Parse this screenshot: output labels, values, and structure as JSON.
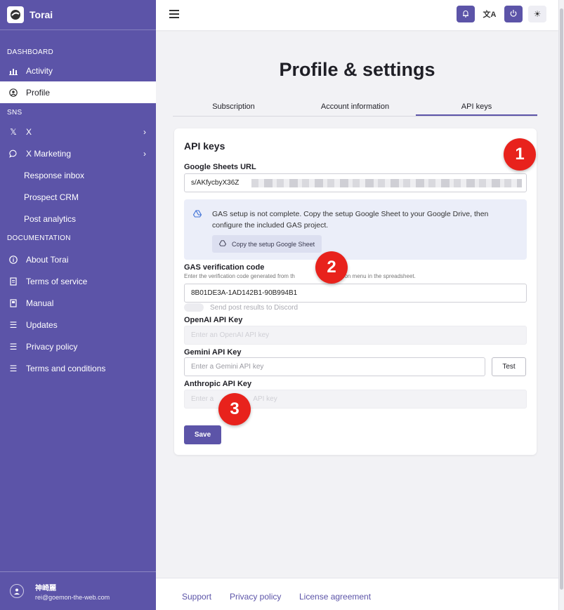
{
  "brand": {
    "name": "Torai"
  },
  "sidebar": {
    "sections": {
      "dashboard": "DASHBOARD",
      "sns": "SNS",
      "documentation": "DOCUMENTATION"
    },
    "items": {
      "activity": "Activity",
      "profile": "Profile",
      "x": "X",
      "x_marketing": "X Marketing",
      "response_inbox": "Response inbox",
      "prospect_crm": "Prospect CRM",
      "post_analytics": "Post analytics",
      "about": "About Torai",
      "terms": "Terms of service",
      "manual": "Manual",
      "updates": "Updates",
      "privacy": "Privacy policy",
      "conditions": "Terms and conditions"
    },
    "user": {
      "name": "神崎麗",
      "email": "rei@goemon-the-web.com"
    }
  },
  "page": {
    "title": "Profile & settings",
    "tabs": [
      "Subscription",
      "Account information",
      "API keys"
    ],
    "active_tab": "API keys"
  },
  "api": {
    "card_title": "API keys",
    "sheets_label": "Google Sheets URL",
    "sheets_value": "s/AKfycbyX36Z",
    "notice_text": "GAS setup is not complete. Copy the setup Google Sheet to your Google Drive, then configure the included GAS project.",
    "notice_button": "Copy the setup Google Sheet",
    "gas_label": "GAS verification code",
    "gas_hint": "Enter the verification code generated from th",
    "gas_hint_end": "gration menu in the spreadsheet.",
    "gas_value": "8B01DE3A-1AD142B1-90B994B1",
    "discord_label": "Send post results to Discord",
    "openai_label": "OpenAI API Key",
    "openai_placeholder": "Enter an OpenAI API key",
    "gemini_label": "Gemini API Key",
    "gemini_placeholder": "Enter a Gemini API key",
    "test_label": "Test",
    "anthropic_label": "Anthropic API Key",
    "anthropic_placeholder": "Enter a",
    "anthropic_placeholder_end": "API key",
    "save_label": "Save"
  },
  "badges": [
    "1",
    "2",
    "3"
  ],
  "footer": {
    "links": [
      "Support",
      "Privacy policy",
      "License agreement"
    ]
  },
  "colors": {
    "accent": "#5c54a8",
    "badge": "#e8221c"
  },
  "icons": {
    "notification": "bell-icon",
    "language": "translate-icon",
    "power": "power-icon",
    "theme": "sun-icon"
  }
}
